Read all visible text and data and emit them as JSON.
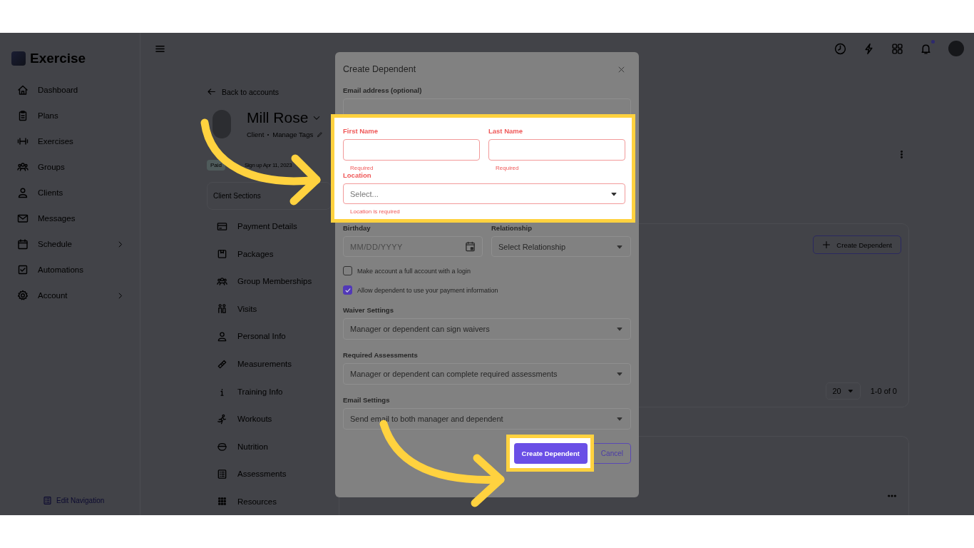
{
  "sidebar": {
    "logo": "Exercise",
    "items": [
      {
        "label": "Dashboard",
        "expandable": false
      },
      {
        "label": "Plans",
        "expandable": false
      },
      {
        "label": "Exercises",
        "expandable": false
      },
      {
        "label": "Groups",
        "expandable": false
      },
      {
        "label": "Clients",
        "expandable": false
      },
      {
        "label": "Messages",
        "expandable": false
      },
      {
        "label": "Schedule",
        "expandable": true
      },
      {
        "label": "Automations",
        "expandable": false
      },
      {
        "label": "Account",
        "expandable": true
      }
    ],
    "edit_navigation": "Edit Navigation"
  },
  "header": {
    "notifications_unread": true
  },
  "client": {
    "back_link": "Back to accounts",
    "name": "Mill Rose",
    "role": "Client",
    "manage_tags": "Manage Tags",
    "badge": "Paid",
    "signup": "Sign up Apr 11, 2023",
    "sections_title": "Client Sections",
    "sections": [
      "Payment Details",
      "Packages",
      "Group Memberships",
      "Visits",
      "Personal Info",
      "Measurements",
      "Training Info",
      "Workouts",
      "Nutrition",
      "Assessments",
      "Resources"
    ]
  },
  "dependents": {
    "create_button": "Create Dependent",
    "page_size": "20",
    "range": "1-0 of 0"
  },
  "modal": {
    "title": "Create Dependent",
    "email": {
      "label": "Email address (optional)"
    },
    "first_name": {
      "label": "First Name",
      "invalid": true,
      "error": "Required"
    },
    "last_name": {
      "label": "Last Name",
      "invalid": true,
      "error": "Required"
    },
    "location": {
      "label": "Location",
      "invalid": true,
      "placeholder": "Select...",
      "error": "Location is required"
    },
    "birthday": {
      "label": "Birthday",
      "placeholder": "MM/DD/YYYY"
    },
    "relationship": {
      "label": "Relationship",
      "value": "Select Relationship"
    },
    "checkboxes": [
      {
        "label": "Make account a full account with a login",
        "checked": false
      },
      {
        "label": "Allow dependent to use your payment information",
        "checked": true
      }
    ],
    "selects": [
      {
        "label": "Waiver Settings",
        "value": "Manager or dependent can sign waivers"
      },
      {
        "label": "Required Assessments",
        "value": "Manager or dependent can complete required assessments"
      },
      {
        "label": "Email Settings",
        "value": "Send email to both manager and dependent"
      }
    ],
    "buttons": [
      {
        "label": "Create Dependent",
        "kind": "primary"
      },
      {
        "label": "Cancel",
        "kind": "secondary"
      }
    ]
  }
}
